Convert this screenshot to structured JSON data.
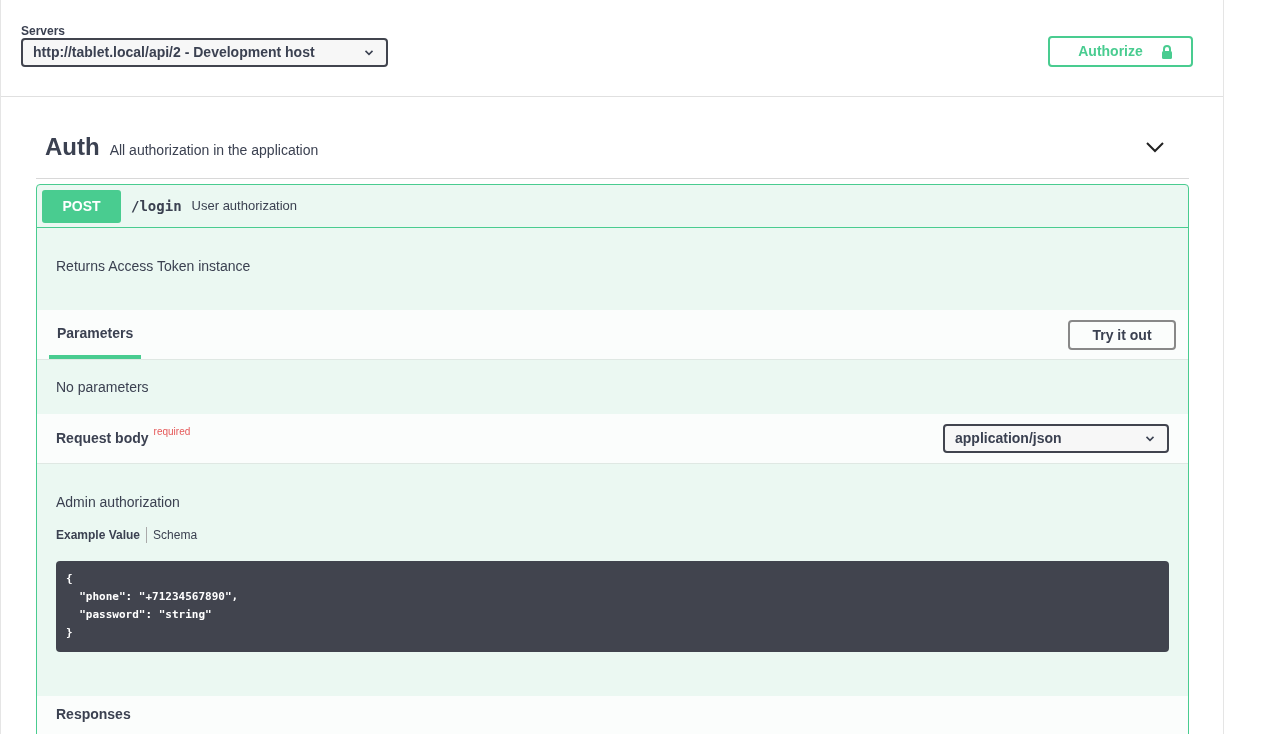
{
  "servers": {
    "label": "Servers",
    "value": "http://tablet.local/api/2 - Development host"
  },
  "authorize_button": {
    "label": "Authorize",
    "locked": true
  },
  "tag": {
    "name": "Auth",
    "description": "All authorization in the application",
    "expanded": true
  },
  "operation": {
    "method": "POST",
    "path": "/login",
    "summary": "User authorization",
    "description": "Returns Access Token instance",
    "tabs": [
      {
        "label": "Parameters",
        "selected": true
      }
    ],
    "try_button": "Try it out",
    "no_parameters": "No parameters",
    "request_body": {
      "title": "Request body",
      "required_label": "required",
      "content_type": "application/json",
      "description": "Admin authorization",
      "example_tabs": [
        {
          "label": "Example Value",
          "selected": true
        },
        {
          "label": "Schema",
          "selected": false
        }
      ],
      "code": "{\n  \"phone\": \"+71234567890\",\n  \"password\": \"string\"\n}"
    },
    "responses_title": "Responses"
  }
}
